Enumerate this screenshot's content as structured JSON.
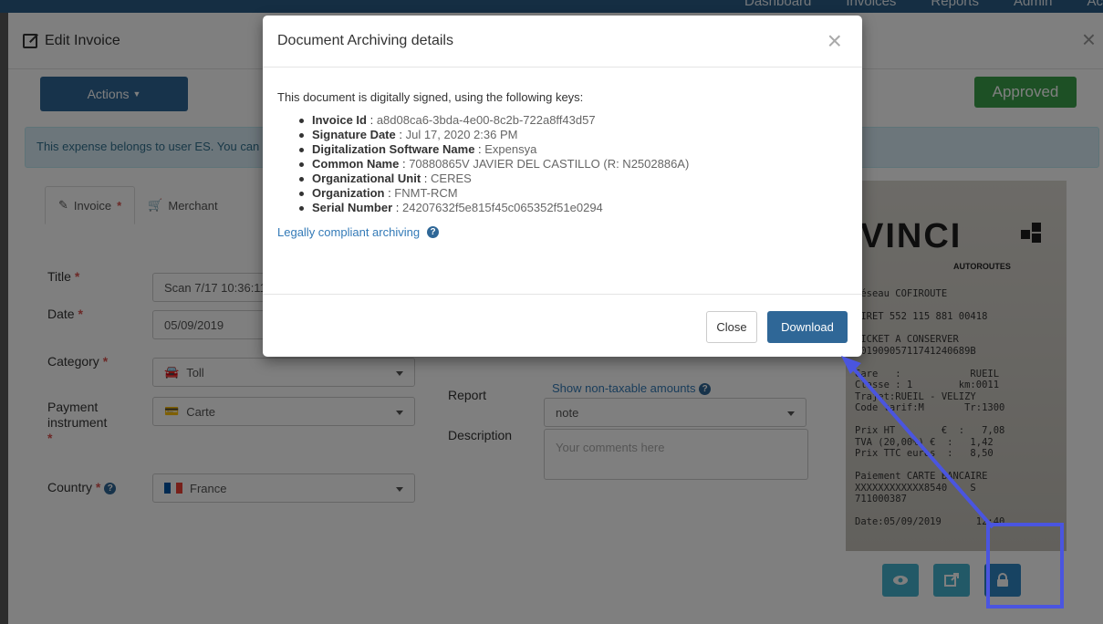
{
  "topnav": {
    "links": [
      "Dashboard",
      "Invoices",
      "Reports",
      "Admin",
      "Ac"
    ]
  },
  "panel": {
    "title": "Edit Invoice",
    "close_glyph": "×",
    "actions_label": "Actions",
    "approved_label": "Approved",
    "info_text": "This expense belongs to user ES. You can m"
  },
  "tabs": [
    {
      "label": "Invoice",
      "icon": "pencil-icon",
      "required": "*"
    },
    {
      "label": "Merchant",
      "icon": "cart-icon"
    }
  ],
  "form": {
    "title": {
      "label": "Title",
      "value": "Scan 7/17 10:36:11"
    },
    "date": {
      "label": "Date",
      "value": "05/09/2019"
    },
    "category": {
      "label": "Category",
      "value": "Toll"
    },
    "payment": {
      "label": "Payment instrument",
      "value": "Carte"
    },
    "country": {
      "label": "Country",
      "value": "France"
    },
    "report": {
      "label": "Report",
      "value": "note"
    },
    "description": {
      "label": "Description",
      "placeholder": "Your comments here"
    },
    "nontaxable_link": "Show non-taxable amounts",
    "required_mark": "*"
  },
  "receipt": {
    "logo": "VINCI",
    "logo_sub": "AUTOROUTES",
    "lines": "réseau COFIROUTE\n\nSIRET 552 115 881 00418\n\nTICKET A CONSERVER\n20190905711741240689B\n\nGare   :            RUEIL\nClasse : 1        km:0011\nTrajet:RUEIL - VELIZY\nCode tarif:M       Tr:1300\n\nPrix HT        €  :   7,08\nTVA (20,00%) €  :   1,42\nPrix TTC euros  :   8,50\n\nPaiement CARTE BANCAIRE\nXXXXXXXXXXXX8540    S\n711000387\n\nDate:05/09/2019      12:40"
  },
  "modal": {
    "title": "Document Archiving details",
    "close_glyph": "×",
    "intro": "This document is digitally signed, using the following keys:",
    "keys": [
      {
        "key": "Invoice Id",
        "value": "a8d08ca6-3bda-4e00-8c2b-722a8ff43d57"
      },
      {
        "key": "Signature Date",
        "value": "Jul 17, 2020 2:36 PM"
      },
      {
        "key": "Digitalization Software Name",
        "value": "Expensya"
      },
      {
        "key": "Common Name",
        "value": "70880865V JAVIER DEL CASTILLO (R: N2502886A)"
      },
      {
        "key": "Organizational Unit",
        "value": "CERES"
      },
      {
        "key": "Organization",
        "value": "FNMT-RCM"
      },
      {
        "key": "Serial Number",
        "value": "24207632f5e815f45c065352f51e0294"
      }
    ],
    "legal_link": "Legally compliant archiving",
    "close_label": "Close",
    "download_label": "Download"
  },
  "colors": {
    "primary": "#2f6797",
    "success": "#3aa14a",
    "info_bg": "#d9edf7",
    "annotation": "#4a55e0"
  }
}
